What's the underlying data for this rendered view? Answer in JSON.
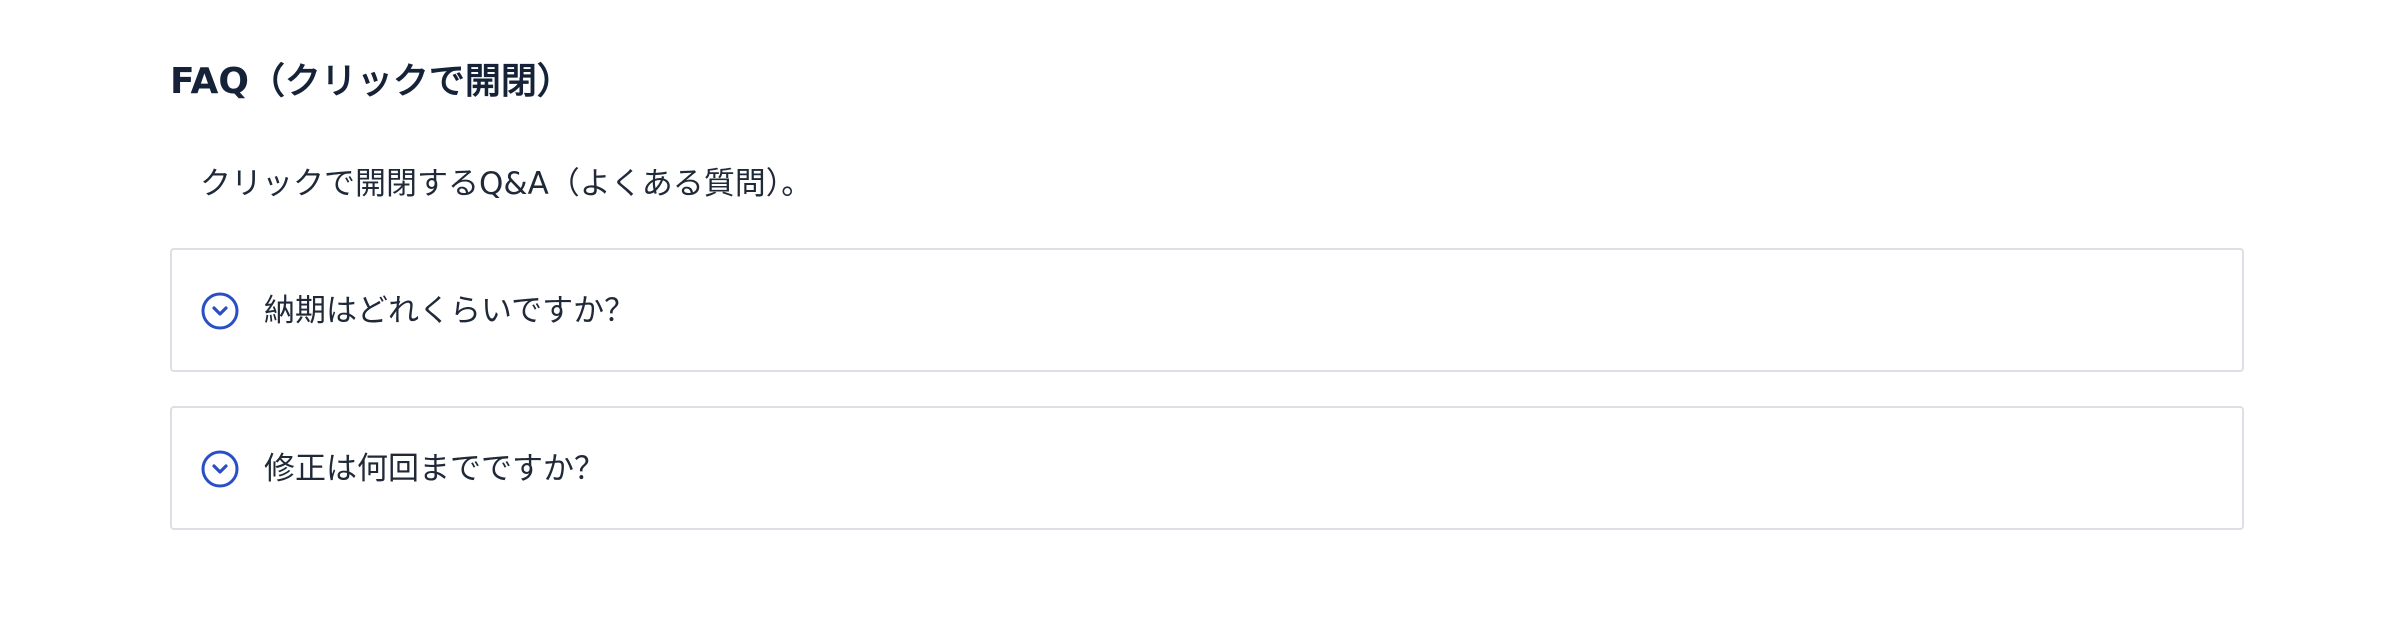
{
  "faq": {
    "title": "FAQ（クリックで開閉）",
    "description": "クリックで開閉するQ&A（よくある質問）。",
    "accent_color": "#2a4fc4",
    "items": [
      {
        "question": "納期はどれくらいですか？",
        "expanded": false,
        "icon": "chevron-down-circle-icon"
      },
      {
        "question": "修正は何回までですか？",
        "expanded": false,
        "icon": "chevron-down-circle-icon"
      }
    ]
  }
}
